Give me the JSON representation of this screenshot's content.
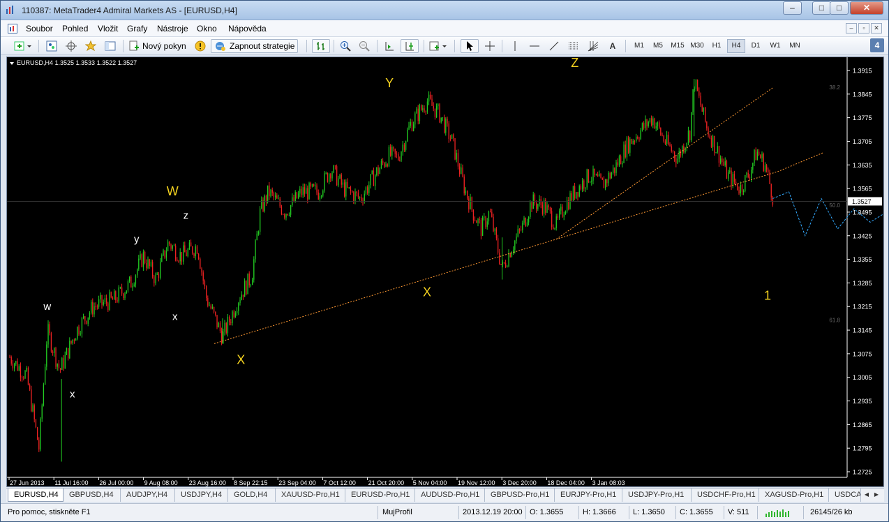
{
  "window": {
    "title": "110387: MetaTrader4 Admiral Markets AS - [EURUSD,H4]",
    "controls": [
      "–",
      "□",
      "✕"
    ]
  },
  "menu": {
    "items": [
      "Soubor",
      "Pohled",
      "Vložit",
      "Grafy",
      "Nástroje",
      "Okno",
      "Nápověda"
    ],
    "mdi_controls": [
      "–",
      "▫",
      "✕"
    ]
  },
  "toolbar": {
    "new_order_label": "Nový pokyn",
    "expert_label": "Zapnout strategie",
    "line_text_tool": "A",
    "timeframes": [
      "M1",
      "M5",
      "M15",
      "M30",
      "H1",
      "H4",
      "D1",
      "W1",
      "MN"
    ],
    "active_timeframe": "H4",
    "badge": "4"
  },
  "chart": {
    "header": "EURUSD,H4  1.3525 1.3533 1.3522 1.3527",
    "current_price": "1.3527",
    "fib_labels": [
      "38.2",
      "50.0",
      "61.8"
    ],
    "wave_labels_major": [
      "W",
      "Y",
      "Z",
      "X",
      "X",
      "1"
    ],
    "wave_labels_minor": [
      "w",
      "x",
      "y",
      "x",
      "z"
    ],
    "colors": {
      "background": "#000000",
      "bull": "#22cc22",
      "bear": "#ee2222",
      "trendline": "#ff9933",
      "projection": "#33aaff",
      "wave_major": "#f4d21f",
      "wave_minor": "#ffffff",
      "price_box": "#ffffff"
    }
  },
  "chart_data": {
    "type": "candlestick",
    "symbol": "EURUSD",
    "timeframe": "H4",
    "x_tick_labels": [
      "27 Jun 2013",
      "11 Jul 16:00",
      "26 Jul 00:00",
      "9 Aug 08:00",
      "23 Aug 16:00",
      "8 Sep 22:15",
      "23 Sep 04:00",
      "7 Oct 12:00",
      "21 Oct 20:00",
      "5 Nov 04:00",
      "19 Nov 12:00",
      "3 Dec 20:00",
      "18 Dec 04:00",
      "3 Jan 08:03"
    ],
    "y_tick_labels": [
      "1.3915",
      "1.3845",
      "1.3775",
      "1.3705",
      "1.3635",
      "1.3565",
      "1.3495",
      "1.3425",
      "1.3355",
      "1.3285",
      "1.3215",
      "1.3145",
      "1.3075",
      "1.3005",
      "1.2935",
      "1.2865",
      "1.2795",
      "1.2725"
    ],
    "ylim": [
      1.2725,
      1.3915
    ],
    "price_path": [
      [
        0,
        1.3065
      ],
      [
        0.02,
        1.301
      ],
      [
        0.035,
        1.2795
      ],
      [
        0.045,
        1.3145
      ],
      [
        0.06,
        1.3025
      ],
      [
        0.08,
        1.3145
      ],
      [
        0.1,
        1.3215
      ],
      [
        0.125,
        1.3235
      ],
      [
        0.145,
        1.3285
      ],
      [
        0.16,
        1.3365
      ],
      [
        0.175,
        1.3295
      ],
      [
        0.19,
        1.3405
      ],
      [
        0.205,
        1.3365
      ],
      [
        0.225,
        1.3395
      ],
      [
        0.235,
        1.3245
      ],
      [
        0.255,
        1.3125
      ],
      [
        0.275,
        1.3245
      ],
      [
        0.29,
        1.3305
      ],
      [
        0.3,
        1.3495
      ],
      [
        0.31,
        1.3555
      ],
      [
        0.33,
        1.3495
      ],
      [
        0.35,
        1.3555
      ],
      [
        0.37,
        1.3555
      ],
      [
        0.385,
        1.3625
      ],
      [
        0.4,
        1.3565
      ],
      [
        0.42,
        1.3535
      ],
      [
        0.44,
        1.3615
      ],
      [
        0.455,
        1.3665
      ],
      [
        0.465,
        1.3655
      ],
      [
        0.48,
        1.3755
      ],
      [
        0.5,
        1.3825
      ],
      [
        0.515,
        1.3785
      ],
      [
        0.53,
        1.3705
      ],
      [
        0.545,
        1.3565
      ],
      [
        0.555,
        1.3495
      ],
      [
        0.565,
        1.3445
      ],
      [
        0.575,
        1.3495
      ],
      [
        0.59,
        1.3325
      ],
      [
        0.6,
        1.3385
      ],
      [
        0.615,
        1.3455
      ],
      [
        0.625,
        1.3525
      ],
      [
        0.64,
        1.3515
      ],
      [
        0.655,
        1.3455
      ],
      [
        0.665,
        1.3515
      ],
      [
        0.68,
        1.3565
      ],
      [
        0.695,
        1.3605
      ],
      [
        0.71,
        1.3575
      ],
      [
        0.725,
        1.3625
      ],
      [
        0.74,
        1.3695
      ],
      [
        0.755,
        1.3735
      ],
      [
        0.77,
        1.3775
      ],
      [
        0.785,
        1.3705
      ],
      [
        0.8,
        1.3655
      ],
      [
        0.815,
        1.3735
      ],
      [
        0.82,
        1.3885
      ],
      [
        0.835,
        1.3745
      ],
      [
        0.85,
        1.3665
      ],
      [
        0.86,
        1.3605
      ],
      [
        0.875,
        1.3565
      ],
      [
        0.885,
        1.3605
      ],
      [
        0.895,
        1.3675
      ],
      [
        0.905,
        1.3635
      ],
      [
        0.915,
        1.3535
      ]
    ],
    "projection": [
      1.3535,
      1.3555,
      1.3425,
      1.3535,
      1.3445,
      1.3505,
      1.3465,
      1.3495,
      1.3285
    ],
    "trendlines": [
      {
        "from": [
          0.245,
          1.3105
        ],
        "to": [
          0.92,
          1.3615
        ]
      },
      {
        "from": [
          0.655,
          1.3415
        ],
        "to": [
          0.915,
          1.3865
        ]
      }
    ]
  },
  "tabs": {
    "items": [
      "EURUSD,H4",
      "GBPUSD,H4",
      "AUDJPY,H4",
      "USDJPY,H4",
      "GOLD,H4",
      "XAUUSD-Pro,H1",
      "EURUSD-Pro,H1",
      "AUDUSD-Pro,H1",
      "GBPUSD-Pro,H1",
      "EURJPY-Pro,H1",
      "USDJPY-Pro,H1",
      "USDCHF-Pro,H1",
      "XAGUSD-Pro,H1",
      "USDCAI"
    ],
    "active": 0
  },
  "status": {
    "help": "Pro pomoc, stiskněte F1",
    "profile": "MujProfil",
    "datetime": "2013.12.19 20:00",
    "open": "O: 1.3655",
    "high": "H: 1.3666",
    "low": "L: 1.3650",
    "close": "C: 1.3655",
    "volume": "V: 511",
    "traffic": "26145/26 kb"
  }
}
